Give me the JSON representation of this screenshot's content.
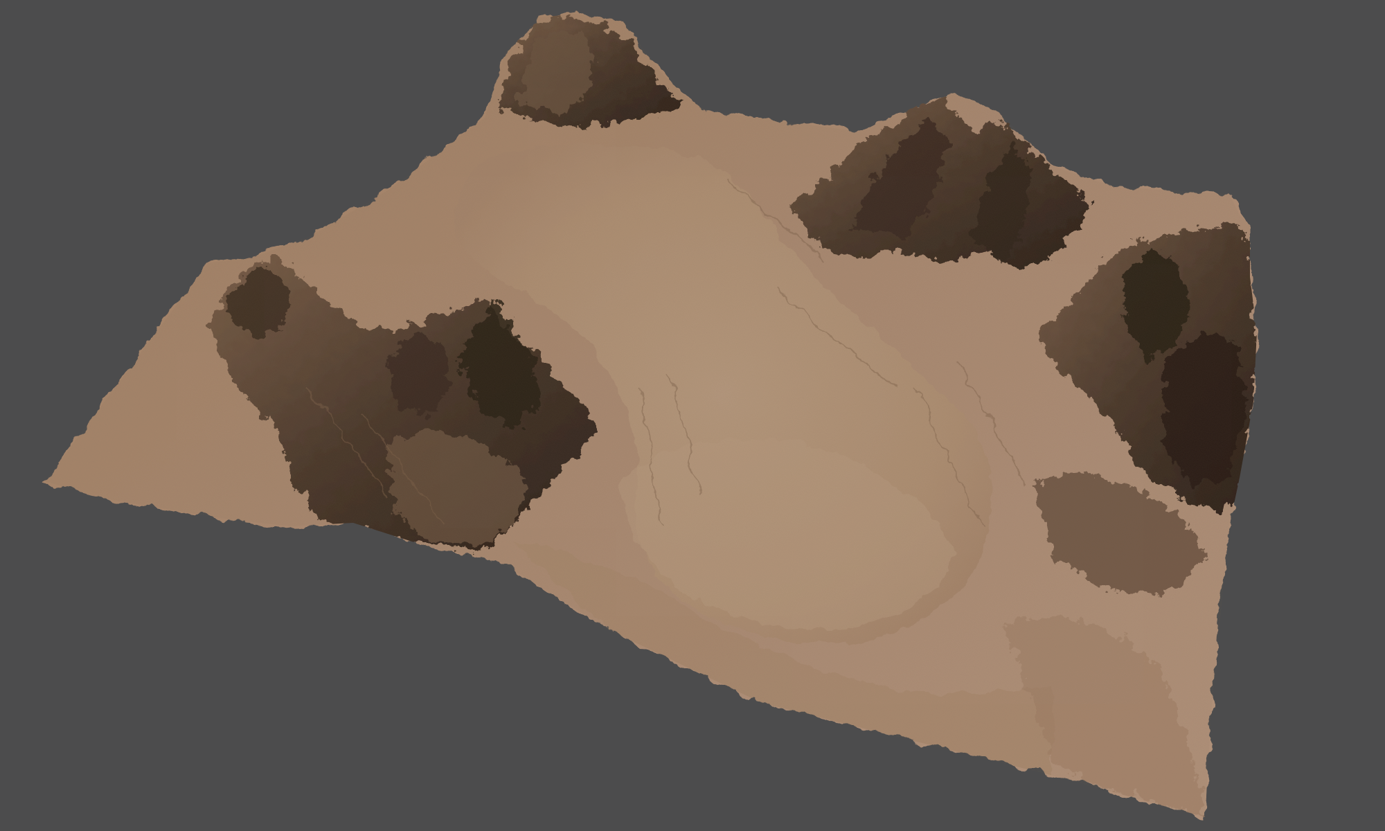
{
  "viewport": {
    "background_color": "#4c4c4d",
    "view": "3d-terrain-render",
    "terrain": {
      "material_base_color": "#a58467",
      "material_light_color": "#b3957a",
      "material_shadow_color": "#3b2d22",
      "material_deep_shadow_color": "#2a2019"
    }
  }
}
